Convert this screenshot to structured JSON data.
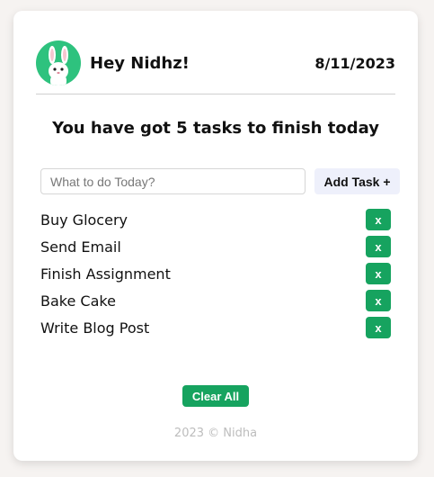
{
  "header": {
    "greeting": "Hey Nidhz!",
    "date": "8/11/2023",
    "avatar_icon": "bunny-avatar-icon"
  },
  "headline": "You have got 5 tasks to finish today",
  "input": {
    "placeholder": "What to do Today?",
    "value": ""
  },
  "add_button_label": "Add Task +",
  "tasks": [
    {
      "text": "Buy Glocery",
      "delete_label": "x"
    },
    {
      "text": "Send Email",
      "delete_label": "x"
    },
    {
      "text": "Finish Assignment",
      "delete_label": "x"
    },
    {
      "text": "Bake Cake",
      "delete_label": "x"
    },
    {
      "text": "Write Blog Post",
      "delete_label": "x"
    }
  ],
  "clear_button_label": "Clear All",
  "footer": "2023 © Nidha",
  "colors": {
    "accent": "#16a35f",
    "avatar_bg": "#2ec27e",
    "add_button_bg": "#eef0fb"
  }
}
